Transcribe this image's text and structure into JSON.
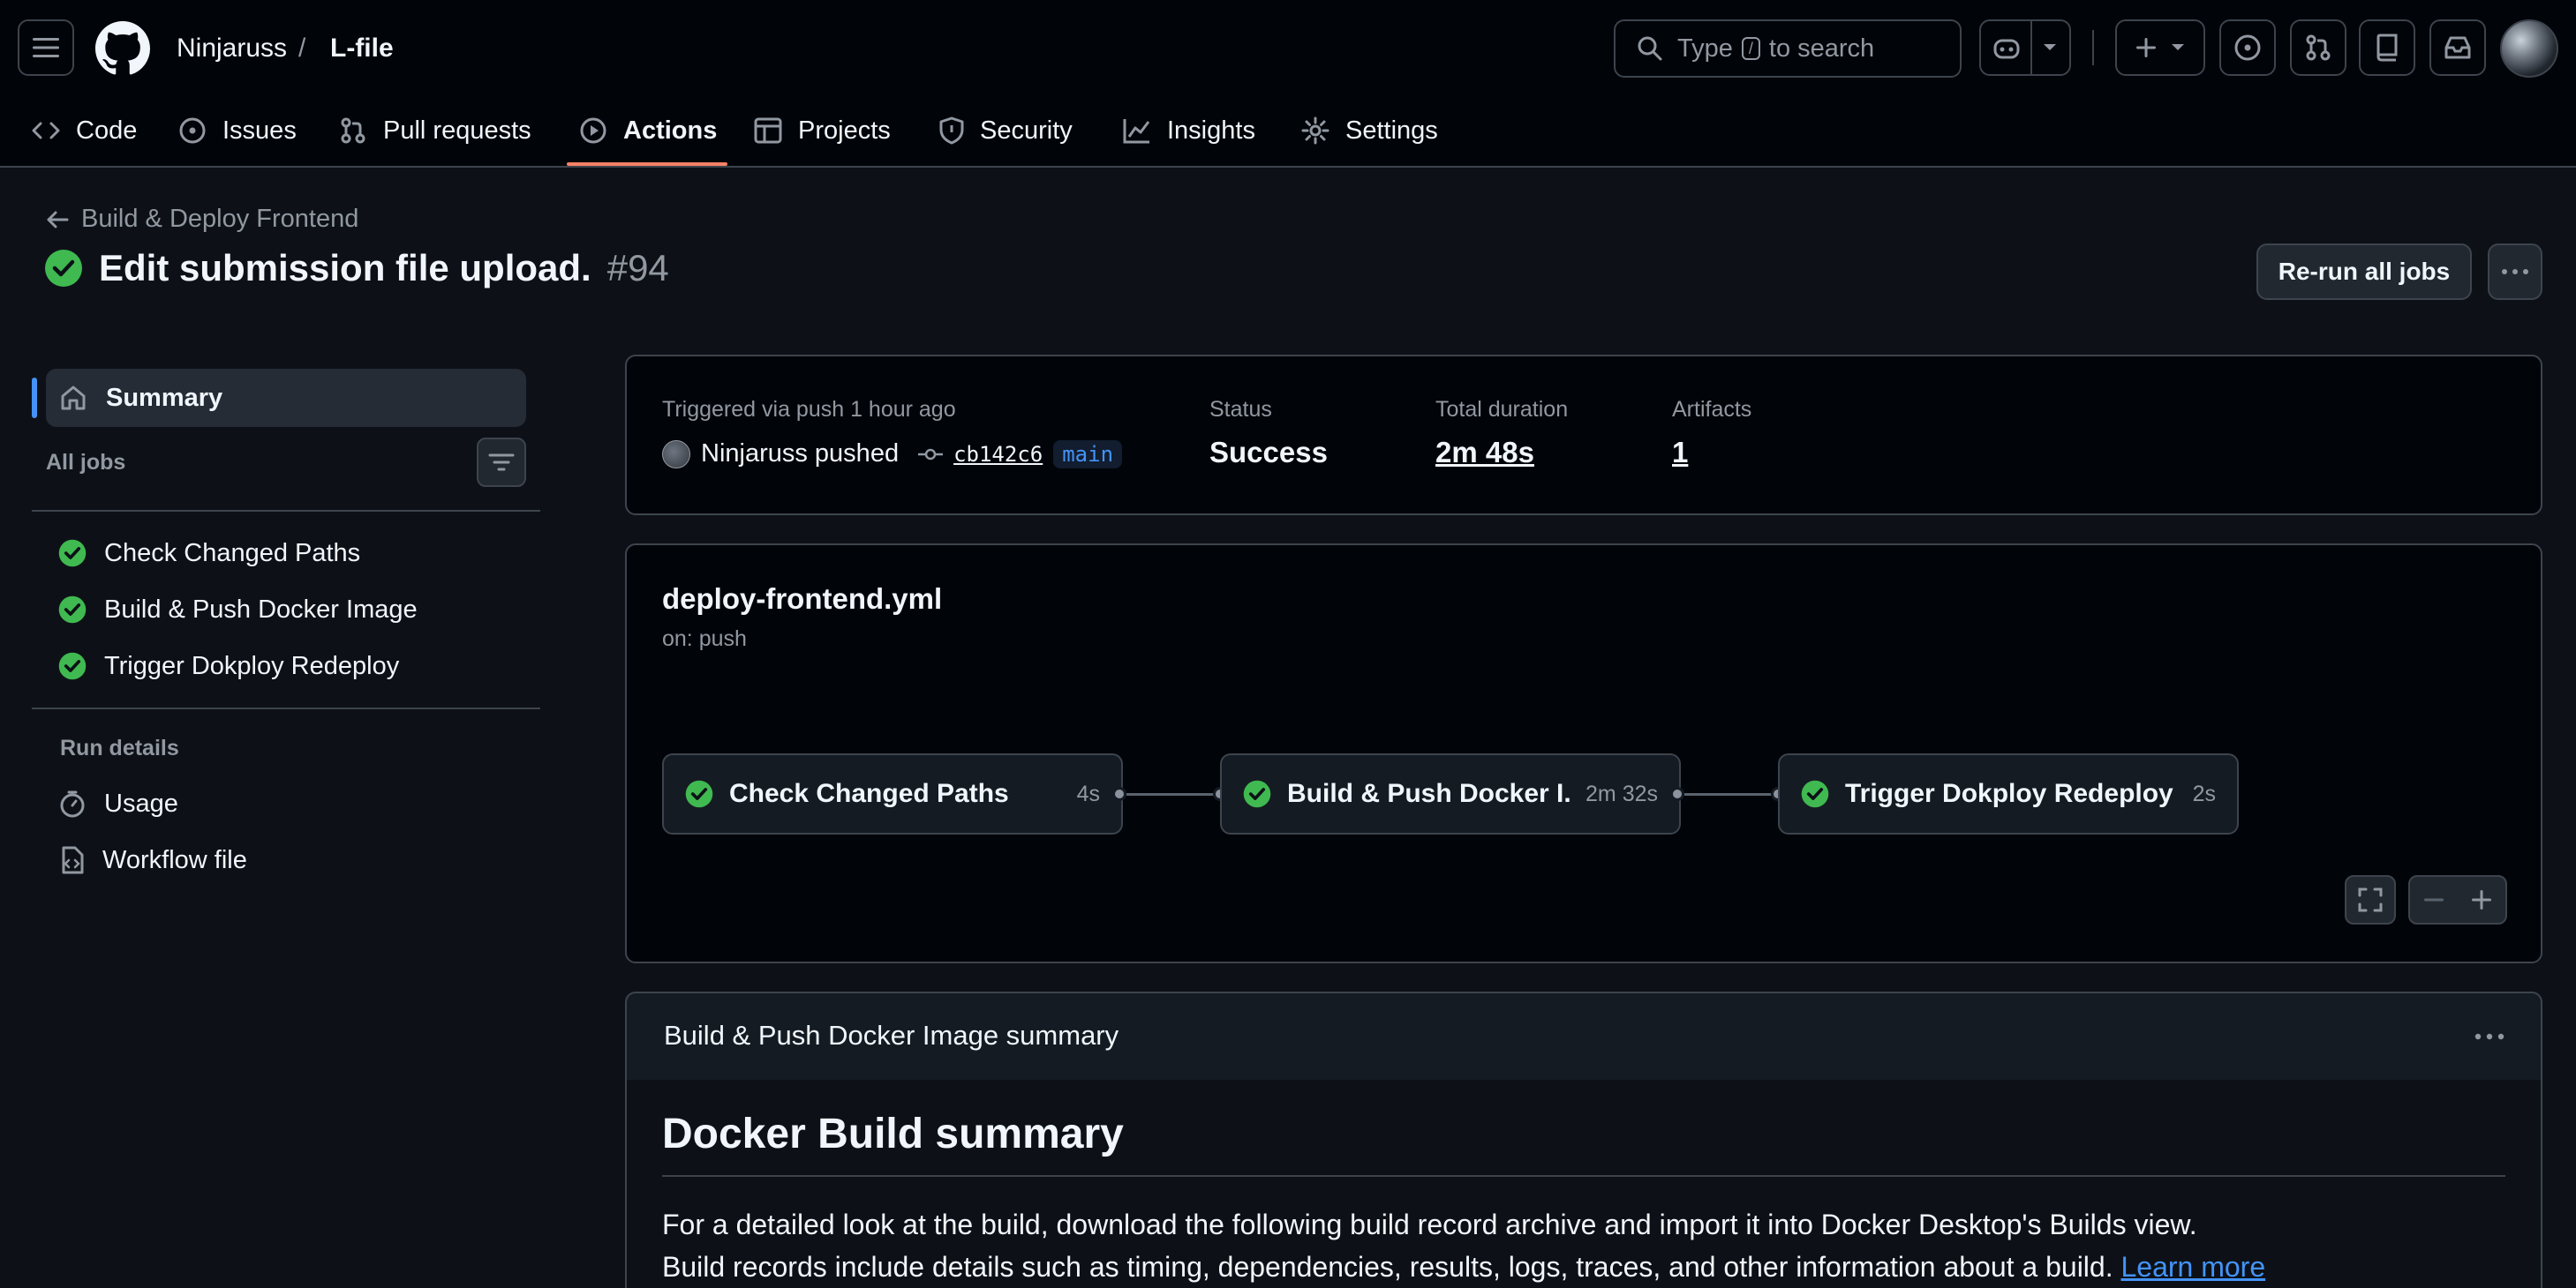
{
  "header": {
    "owner": "Ninjaruss",
    "separator": "/",
    "repo": "L-file",
    "search": {
      "prefix": "Type",
      "key": "/",
      "suffix": "to search"
    }
  },
  "tabs": [
    {
      "label": "Code",
      "icon": "code-icon"
    },
    {
      "label": "Issues",
      "icon": "issue-icon"
    },
    {
      "label": "Pull requests",
      "icon": "pull-request-icon"
    },
    {
      "label": "Actions",
      "icon": "play-icon",
      "active": true
    },
    {
      "label": "Projects",
      "icon": "table-icon"
    },
    {
      "label": "Security",
      "icon": "shield-icon"
    },
    {
      "label": "Insights",
      "icon": "graph-icon"
    },
    {
      "label": "Settings",
      "icon": "gear-icon"
    }
  ],
  "run": {
    "back_label": "Build & Deploy Frontend",
    "title": "Edit submission file upload.",
    "number": "#94",
    "rerun_label": "Re-run all jobs"
  },
  "sidebar": {
    "summary_label": "Summary",
    "all_jobs_label": "All jobs",
    "jobs": [
      {
        "label": "Check Changed Paths"
      },
      {
        "label": "Build & Push Docker Image"
      },
      {
        "label": "Trigger Dokploy Redeploy"
      }
    ],
    "run_details_label": "Run details",
    "details": [
      {
        "label": "Usage",
        "icon": "stopwatch-icon"
      },
      {
        "label": "Workflow file",
        "icon": "file-code-icon"
      }
    ]
  },
  "trigger": {
    "label": "Triggered via push 1 hour ago",
    "actor": "Ninjaruss pushed",
    "sha": "cb142c6",
    "branch": "main"
  },
  "status": {
    "label": "Status",
    "value": "Success"
  },
  "duration": {
    "label": "Total duration",
    "value": "2m 48s"
  },
  "artifacts": {
    "label": "Artifacts",
    "value": "1"
  },
  "workflow": {
    "file": "deploy-frontend.yml",
    "on": "on: push",
    "nodes": [
      {
        "name": "Check Changed Paths",
        "duration": "4s"
      },
      {
        "name": "Build & Push Docker I...",
        "duration": "2m 32s"
      },
      {
        "name": "Trigger Dokploy Redeploy",
        "duration": "2s"
      }
    ]
  },
  "job_summary": {
    "header": "Build & Push Docker Image summary",
    "heading": "Docker Build summary",
    "line1": "For a detailed look at the build, download the following build record archive and import it into Docker Desktop's Builds view.",
    "line2": "Build records include details such as timing, dependencies, results, logs, traces, and other information about a build.",
    "learn_more": "Learn more"
  },
  "colors": {
    "success": "#3fb950",
    "accent": "#4493f8",
    "tab_underline": "#f78166"
  }
}
